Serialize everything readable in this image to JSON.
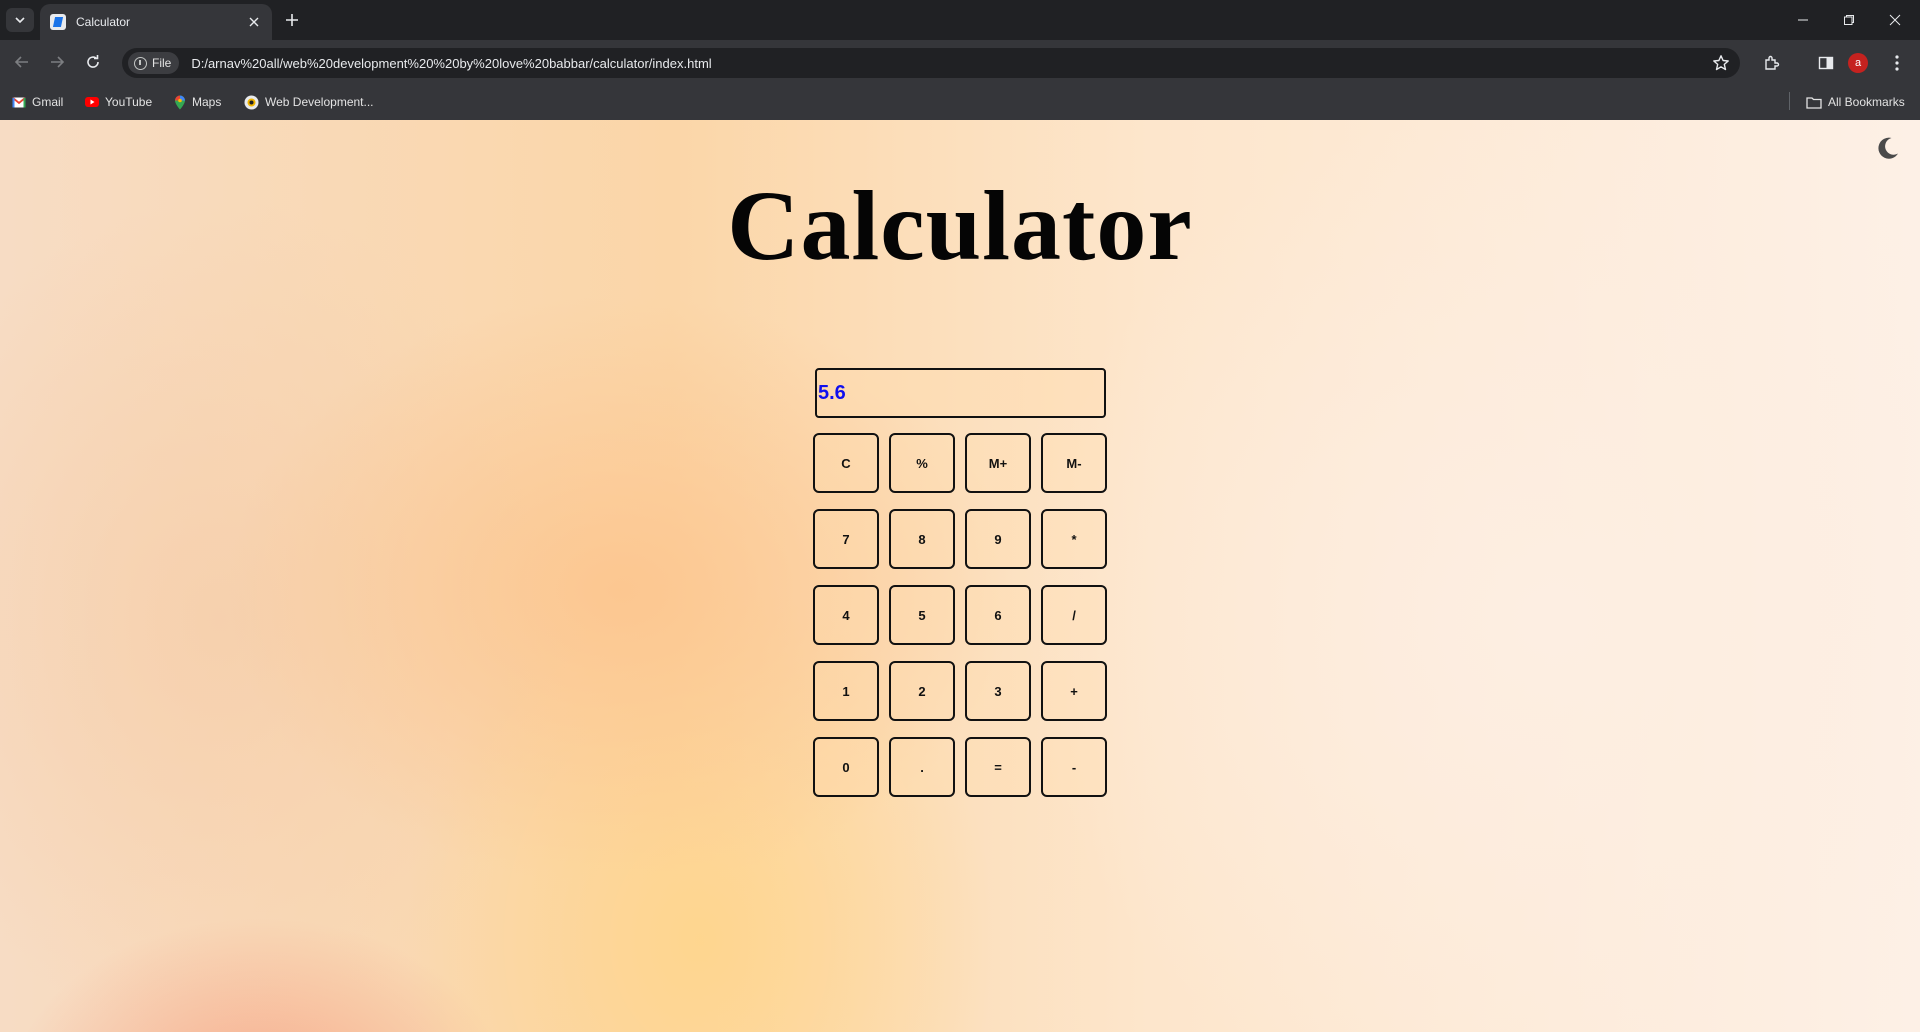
{
  "browser": {
    "tab_title": "Calculator",
    "omnibox_chip": "File",
    "url": "D:/arnav%20all/web%20development%20%20by%20love%20babbar/calculator/index.html",
    "profile_initial": "a",
    "bookmarks": [
      {
        "label": "Gmail",
        "icon": "gmail-icon"
      },
      {
        "label": "YouTube",
        "icon": "youtube-icon"
      },
      {
        "label": "Maps",
        "icon": "maps-icon"
      },
      {
        "label": "Web Development...",
        "icon": "site-icon"
      }
    ],
    "all_bookmarks_label": "All Bookmarks"
  },
  "page": {
    "heading": "Calculator",
    "display_value": "5.6",
    "theme_toggle_icon": "moon-icon",
    "keys": [
      "C",
      "%",
      "M+",
      "M-",
      "7",
      "8",
      "9",
      "*",
      "4",
      "5",
      "6",
      "/",
      "1",
      "2",
      "3",
      "+",
      "0",
      ".",
      "=",
      "-"
    ]
  },
  "colors": {
    "display_text": "#1010ee",
    "chrome_dark": "#202124",
    "chrome_toolbar": "#35363a"
  }
}
